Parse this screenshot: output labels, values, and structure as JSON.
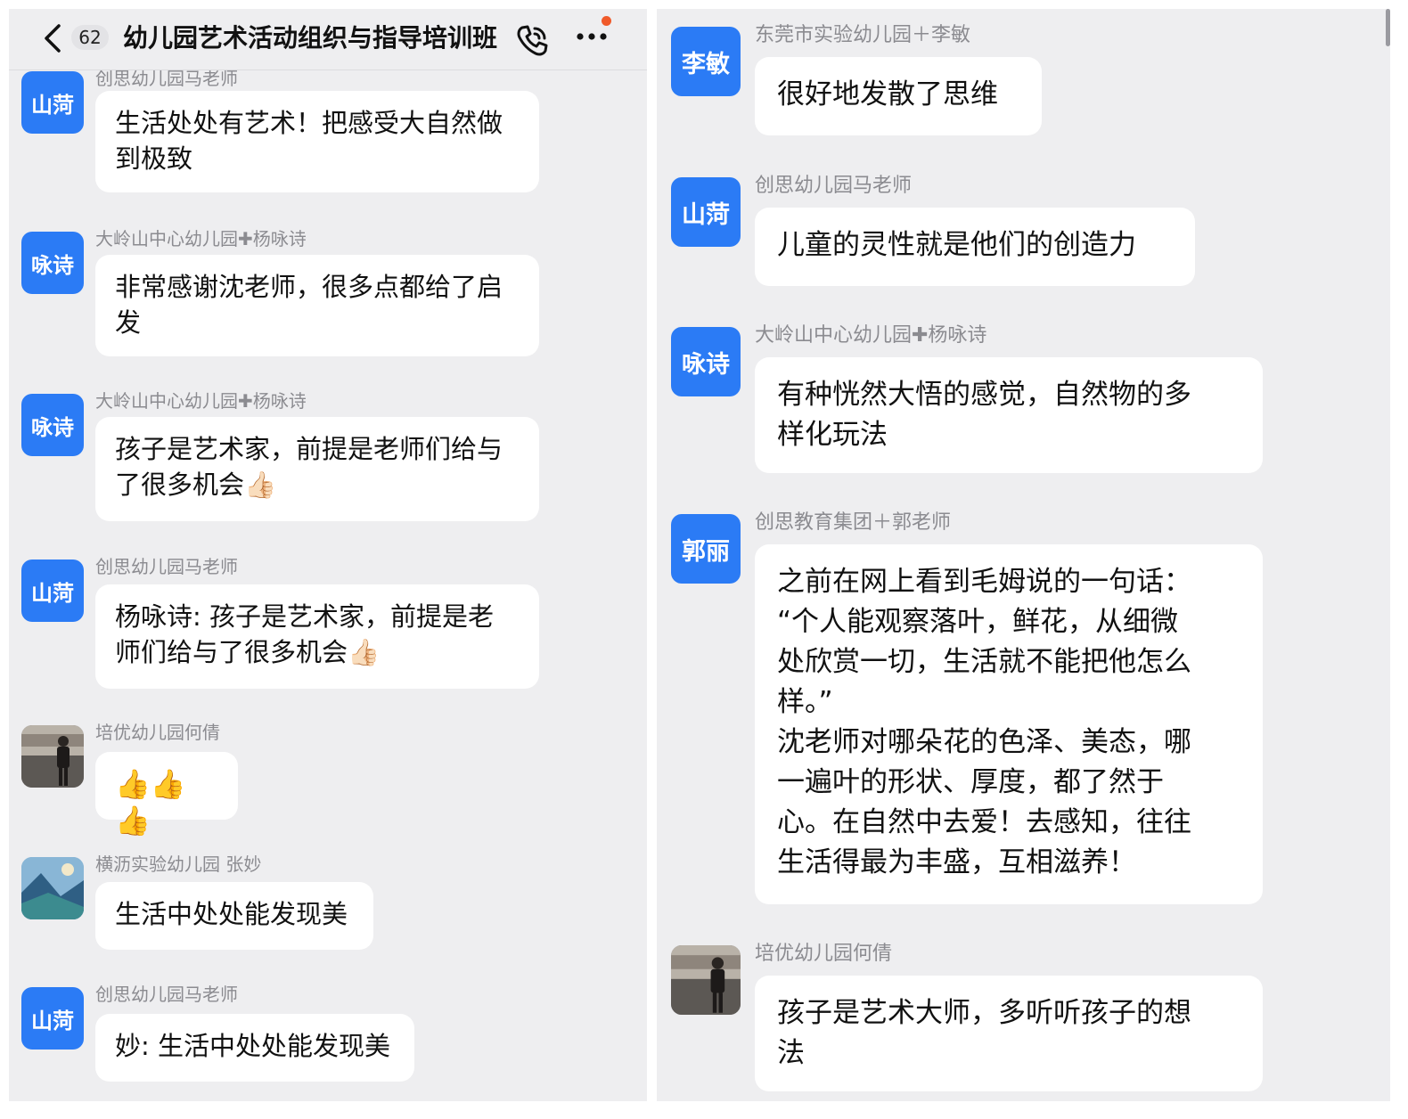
{
  "header": {
    "unread_count": "62",
    "title": "幼儿园艺术活动组织与指导培训班"
  },
  "left_messages": [
    {
      "avatar": "山菏",
      "sender": "创思幼儿园马老师",
      "lines": [
        "生活处处有艺术！把感受大自然做",
        "到极致"
      ]
    },
    {
      "avatar": "咏诗",
      "sender": "大岭山中心幼儿园✚杨咏诗",
      "lines": [
        "非常感谢沈老师，很多点都给了启",
        "发"
      ]
    },
    {
      "avatar": "咏诗",
      "sender": "大岭山中心幼儿园✚杨咏诗",
      "lines": [
        "孩子是艺术家，前提是老师们给与",
        "了很多机会👍🏻"
      ]
    },
    {
      "avatar": "山菏",
      "sender": "创思幼儿园马老师",
      "lines": [
        "杨咏诗: 孩子是艺术家，前提是老",
        "师们给与了很多机会👍🏻"
      ]
    },
    {
      "avatar": "",
      "sender": "培优幼儿园何倩",
      "lines": [
        "👍👍👍"
      ]
    },
    {
      "avatar": "",
      "sender": "横沥实验幼儿园  张妙",
      "lines": [
        "生活中处处能发现美"
      ]
    },
    {
      "avatar": "山菏",
      "sender": "创思幼儿园马老师",
      "lines": [
        "妙: 生活中处处能发现美"
      ]
    }
  ],
  "right_messages": [
    {
      "avatar": "李敏",
      "sender": "东莞市实验幼儿园＋李敏",
      "lines": [
        "很好地发散了思维"
      ]
    },
    {
      "avatar": "山菏",
      "sender": "创思幼儿园马老师",
      "lines": [
        "儿童的灵性就是他们的创造力"
      ]
    },
    {
      "avatar": "咏诗",
      "sender": "大岭山中心幼儿园✚杨咏诗",
      "lines": [
        "有种恍然大悟的感觉，自然物的多",
        "样化玩法"
      ]
    },
    {
      "avatar": "郭丽",
      "sender": "创思教育集团＋郭老师",
      "lines": [
        "之前在网上看到毛姆说的一句话：",
        "“个人能观察落叶，鲜花，从细微",
        "处欣赏一切，生活就不能把他怎么",
        "样。”",
        "沈老师对哪朵花的色泽、美态，哪",
        "一遍叶的形状、厚度，都了然于",
        "心。在自然中去爱！去感知，往往",
        "生活得最为丰盛，互相滋养！"
      ]
    },
    {
      "avatar": "",
      "sender": "培优幼儿园何倩",
      "lines": [
        "孩子是艺术大师，多听听孩子的想",
        "法"
      ]
    }
  ],
  "colors": {
    "avatar_blue": "#2b7bf5",
    "chat_background": "#eeeef0",
    "bubble": "#ffffff",
    "sender_gray": "#8b8b90",
    "notification_dot": "#f05a2a"
  },
  "icons": [
    "back-arrow-icon",
    "call-icon",
    "more-icon"
  ]
}
